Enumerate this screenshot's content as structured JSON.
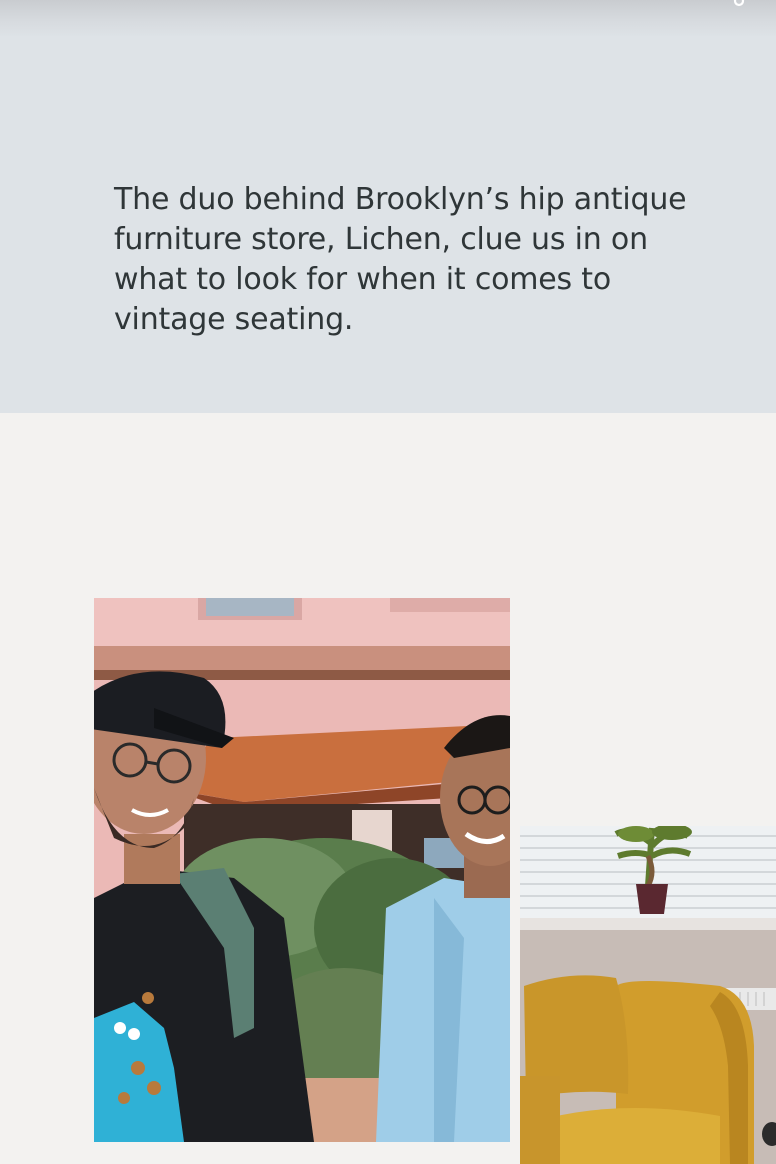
{
  "article": {
    "intro": "The duo behind Brooklyn’s hip antique furniture store, Lichen, clue us in on what to look for when it comes to vintage seating."
  },
  "header": {
    "icon": "menu-icon"
  },
  "gallery": {
    "images": [
      {
        "name": "photo-lichen-duo",
        "subject": "two men smiling outside a pink building"
      },
      {
        "name": "photo-yellow-armchair",
        "subject": "mustard yellow armchair by a window with a plant"
      }
    ]
  },
  "colors": {
    "intro_bg": "#dee3e7",
    "page_bg": "#f3f2f0",
    "text": "#2f3638"
  }
}
